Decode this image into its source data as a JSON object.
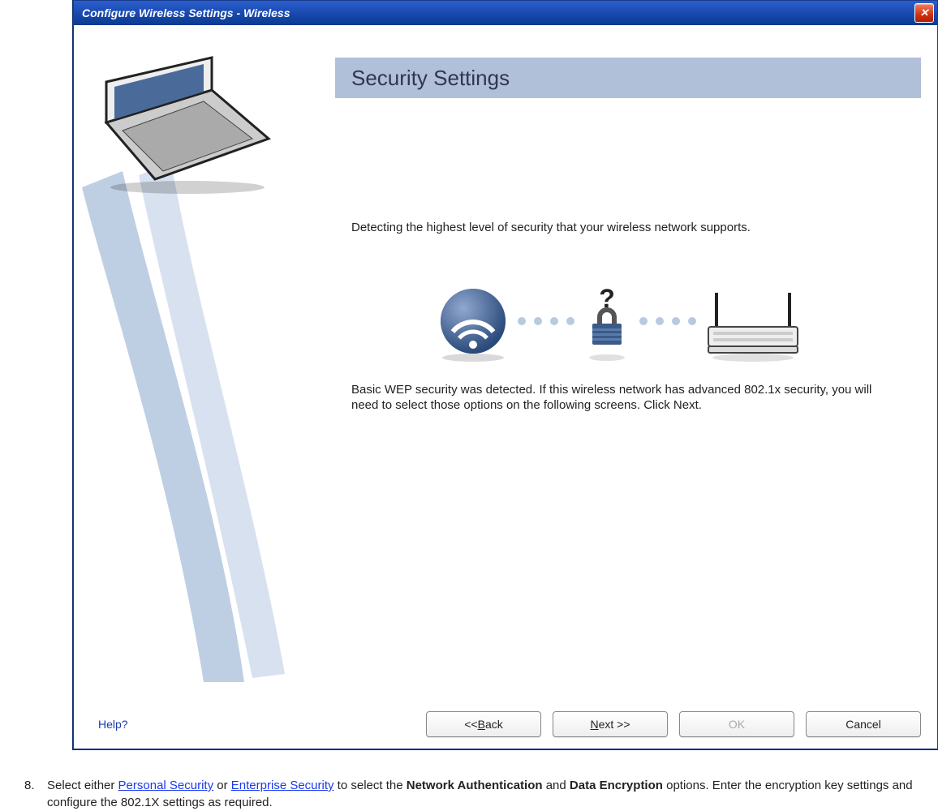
{
  "window": {
    "title": "Configure Wireless Settings  -  Wireless"
  },
  "header": {
    "title": "Security Settings"
  },
  "content": {
    "paragraph1": "Detecting the highest level of security that your wireless network supports.",
    "paragraph2": "Basic WEP security was detected. If this wireless network has advanced 802.1x security, you will need to select those options on the following screens. Click Next."
  },
  "buttons": {
    "help": "Help?",
    "back": "<< Back",
    "next": "Next >>",
    "ok": "OK",
    "cancel": "Cancel"
  },
  "instruction": {
    "number": "8.",
    "prefix": "Select either ",
    "link1": "Personal Security",
    "mid1": " or ",
    "link2": "Enterprise Security",
    "mid2": " to select the ",
    "bold1": "Network Authentication",
    "mid3": " and ",
    "bold2": "Data Encryption",
    "suffix": " options. Enter the encryption key settings and configure the 802.1X settings as required."
  }
}
